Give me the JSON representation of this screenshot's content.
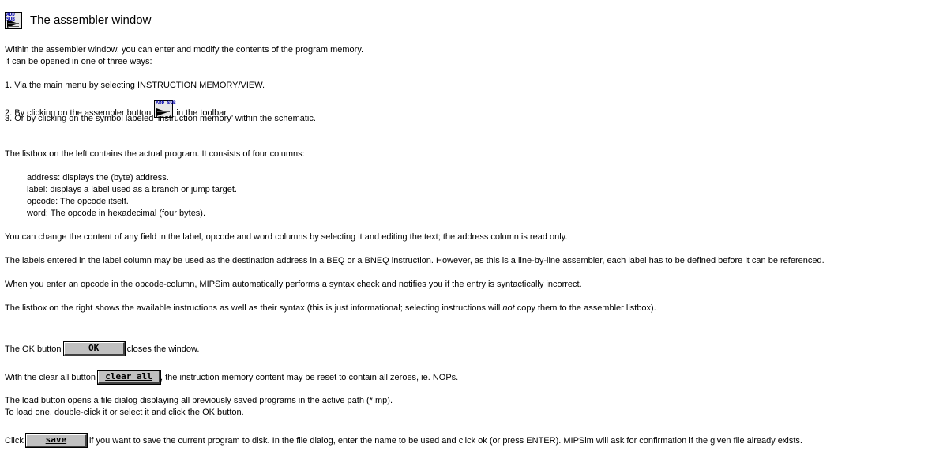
{
  "title": "The assembler window",
  "intro": [
    "Within the assembler window, you can enter and modify the contents of the program memory.",
    "It can be opened in one of three ways:"
  ],
  "ways": {
    "way1": "1. Via the main menu by selecting INSTRUCTION MEMORY/VIEW.",
    "way2_before": "2. By clicking on the assembler button ",
    "way2_after": " in the toolbar",
    "way3": "3. Or by clicking on the symbol labeled ‘instruction memory’ within the schematic."
  },
  "icon": {
    "name": "assembler-icon",
    "text": "ADD SUB"
  },
  "listbox_intro": "The listbox on the left contains the actual program. It consists of four columns:",
  "columns": [
    "address: displays the (byte) address.",
    "label: displays a label used as a branch or jump target.",
    "opcode: The opcode itself.",
    "word: The opcode in hexadecimal (four bytes)."
  ],
  "paragraphs": {
    "change": "You can change the content of any field in the label, opcode and word columns by selecting it and editing the text; the address column is read only.",
    "labels": "The labels entered in the label column may be used as the destination address in a BEQ or a BNEQ instruction. However, as this is a line-by-line assembler, each label has to be defined before it can be referenced.",
    "syntax": "When you enter an opcode in the opcode-column, MIPSim automatically performs a syntax check and notifies you if the entry is syntactically incorrect.",
    "right_before": "The listbox on the right shows the available instructions as well as their syntax (this is just informational; selecting instructions will ",
    "right_em": "not",
    "right_after": " copy them to the assembler listbox).",
    "ok_before": "The OK button ",
    "ok_after": " closes the window.",
    "clear_before": "With the clear all button ",
    "clear_after": ", the instruction memory content may be reset to contain all zeroes, ie. NOPs.",
    "load1": "The load button opens a file dialog displaying all previously saved programs in the active path (*.mp).",
    "load2": "To load one, double-click it or select it and click the OK button.",
    "save_before": "Click ",
    "save_after": " if you want to save the current program to disk. In the file dialog, enter the name to be used and click ok (or press ENTER). MIPSim will ask for confirmation if the given file already exists."
  },
  "buttons": {
    "ok": "OK",
    "clear_all": "clear all",
    "save": "save"
  }
}
